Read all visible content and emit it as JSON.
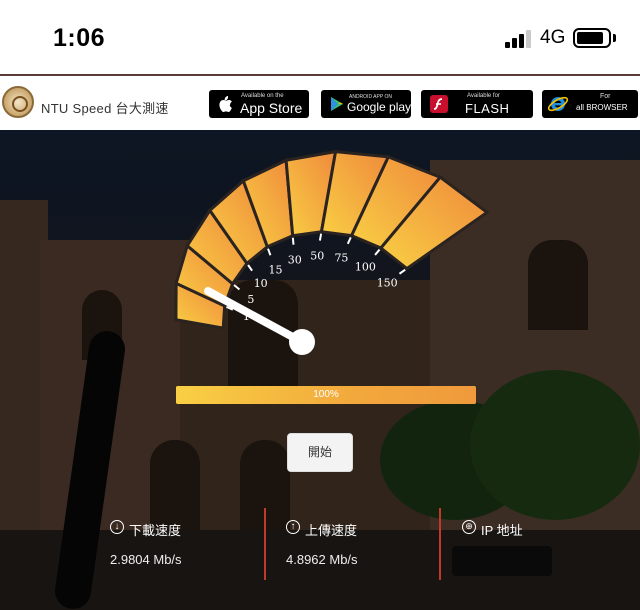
{
  "status_bar": {
    "time": "1:06",
    "network": "4G",
    "signal_bars_filled": 3,
    "signal_bars_total": 4,
    "battery_level": 0.75
  },
  "header": {
    "site_title": "NTU Speed 台大測速",
    "badges": [
      {
        "id": "app-store",
        "small": "Available on the",
        "big": "App Store",
        "icon": "apple-icon"
      },
      {
        "id": "google-play",
        "small": "ANDROID APP ON",
        "big": "Google play",
        "icon": "play-icon"
      },
      {
        "id": "flash",
        "small": "Available for",
        "big": "FLASH",
        "icon": "flash-icon"
      },
      {
        "id": "browser",
        "small": "For",
        "big": "all BROWSER",
        "icon": "ie-icon"
      }
    ]
  },
  "gauge": {
    "ticks": [
      "1",
      "5",
      "10",
      "15",
      "30",
      "50",
      "75",
      "100",
      "150"
    ],
    "needle_value": "5",
    "colors": {
      "start": "#f9cf44",
      "end": "#ef8a3c",
      "needle": "#ffffff"
    }
  },
  "progress": {
    "value": 100,
    "label": "100%"
  },
  "start_button": {
    "label": "開始"
  },
  "stats": {
    "download": {
      "label": "下載速度",
      "value": "2.9804 Mb/s",
      "icon": "download-icon"
    },
    "upload": {
      "label": "上傳速度",
      "value": "4.8962 Mb/s",
      "icon": "upload-icon"
    },
    "ip": {
      "label": "IP 地址",
      "icon": "globe-icon"
    }
  }
}
